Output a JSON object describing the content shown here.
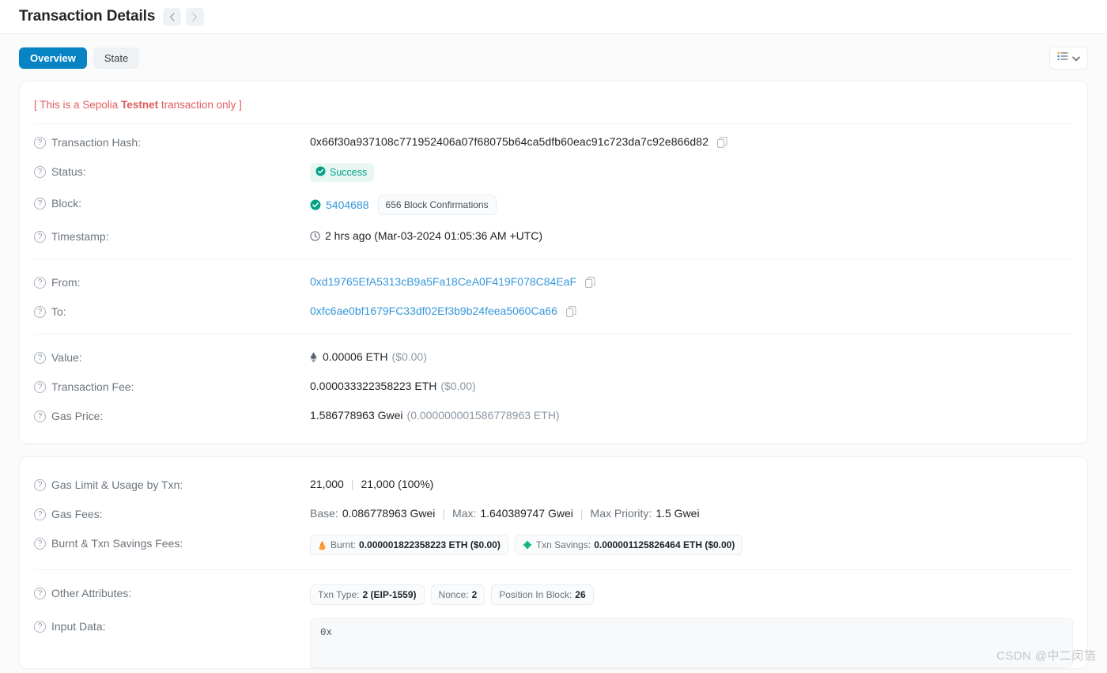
{
  "header": {
    "title": "Transaction Details",
    "prev_icon": "chevron-left-icon",
    "next_icon": "chevron-right-icon"
  },
  "tabs": [
    {
      "label": "Overview",
      "active": true
    },
    {
      "label": "State",
      "active": false
    }
  ],
  "toolbar": {
    "list_icon": "list-view-icon",
    "chevron_icon": "chevron-down-icon"
  },
  "notice": {
    "prefix": "[ This is a Sepolia ",
    "bold": "Testnet",
    "suffix": " transaction only ]",
    "color": "#e05c5c"
  },
  "overview": {
    "rows": {
      "tx_hash": {
        "label": "Transaction Hash:",
        "value": "0x66f30a937108c771952406a07f68075b64ca5dfb60eac91c723da7c92e866d82",
        "copy_icon": "copy-icon"
      },
      "status": {
        "label": "Status:",
        "badge": "Success",
        "badge_icon": "check-circle-icon",
        "badge_bg": "#e8f7f1",
        "badge_color": "#00a186"
      },
      "block": {
        "label": "Block:",
        "check_icon": "check-circle-icon",
        "number": "5404688",
        "confirmations": "656 Block Confirmations"
      },
      "timestamp": {
        "label": "Timestamp:",
        "clock_icon": "clock-icon",
        "value": "2 hrs ago (Mar-03-2024 01:05:36 AM +UTC)"
      },
      "from": {
        "label": "From:",
        "address": "0xd19765EfA5313cB9a5Fa18CeA0F419F078C84EaF",
        "copy_icon": "copy-icon"
      },
      "to": {
        "label": "To:",
        "address": "0xfc6ae0bf1679FC33df02Ef3b9b24feea5060Ca66",
        "copy_icon": "copy-icon"
      },
      "value": {
        "label": "Value:",
        "eth_icon": "ethereum-icon",
        "amount": "0.00006 ETH",
        "fiat": "($0.00)"
      },
      "tx_fee": {
        "label": "Transaction Fee:",
        "amount": "0.000033322358223 ETH",
        "fiat": "($0.00)"
      },
      "gas_price": {
        "label": "Gas Price:",
        "amount": "1.586778963 Gwei",
        "eth_equiv": "(0.000000001586778963 ETH)"
      }
    }
  },
  "details": {
    "rows": {
      "gas_limit": {
        "label": "Gas Limit & Usage by Txn:",
        "limit": "21,000",
        "separator": "|",
        "usage": "21,000 (100%)"
      },
      "gas_fees": {
        "label": "Gas Fees:",
        "base_label": "Base:",
        "base_value": "0.086778963 Gwei",
        "max_label": "Max:",
        "max_value": "1.640389747 Gwei",
        "max_priority_label": "Max Priority:",
        "max_priority_value": "1.5 Gwei",
        "separator": "|"
      },
      "burnt": {
        "label": "Burnt & Txn Savings Fees:",
        "burnt_icon": "flame-icon",
        "burnt_label": "Burnt:",
        "burnt_value": "0.000001822358223 ETH ($0.00)",
        "savings_icon": "gem-icon",
        "savings_label": "Txn Savings:",
        "savings_value": "0.000001125826464 ETH ($0.00)"
      },
      "other": {
        "label": "Other Attributes:",
        "chips": [
          {
            "key": "Txn Type:",
            "val": "2 (EIP-1559)"
          },
          {
            "key": "Nonce:",
            "val": "2"
          },
          {
            "key": "Position In Block:",
            "val": "26"
          }
        ]
      },
      "input_data": {
        "label": "Input Data:",
        "value": "0x"
      }
    }
  },
  "watermark": "CSDN @中二闵箔"
}
